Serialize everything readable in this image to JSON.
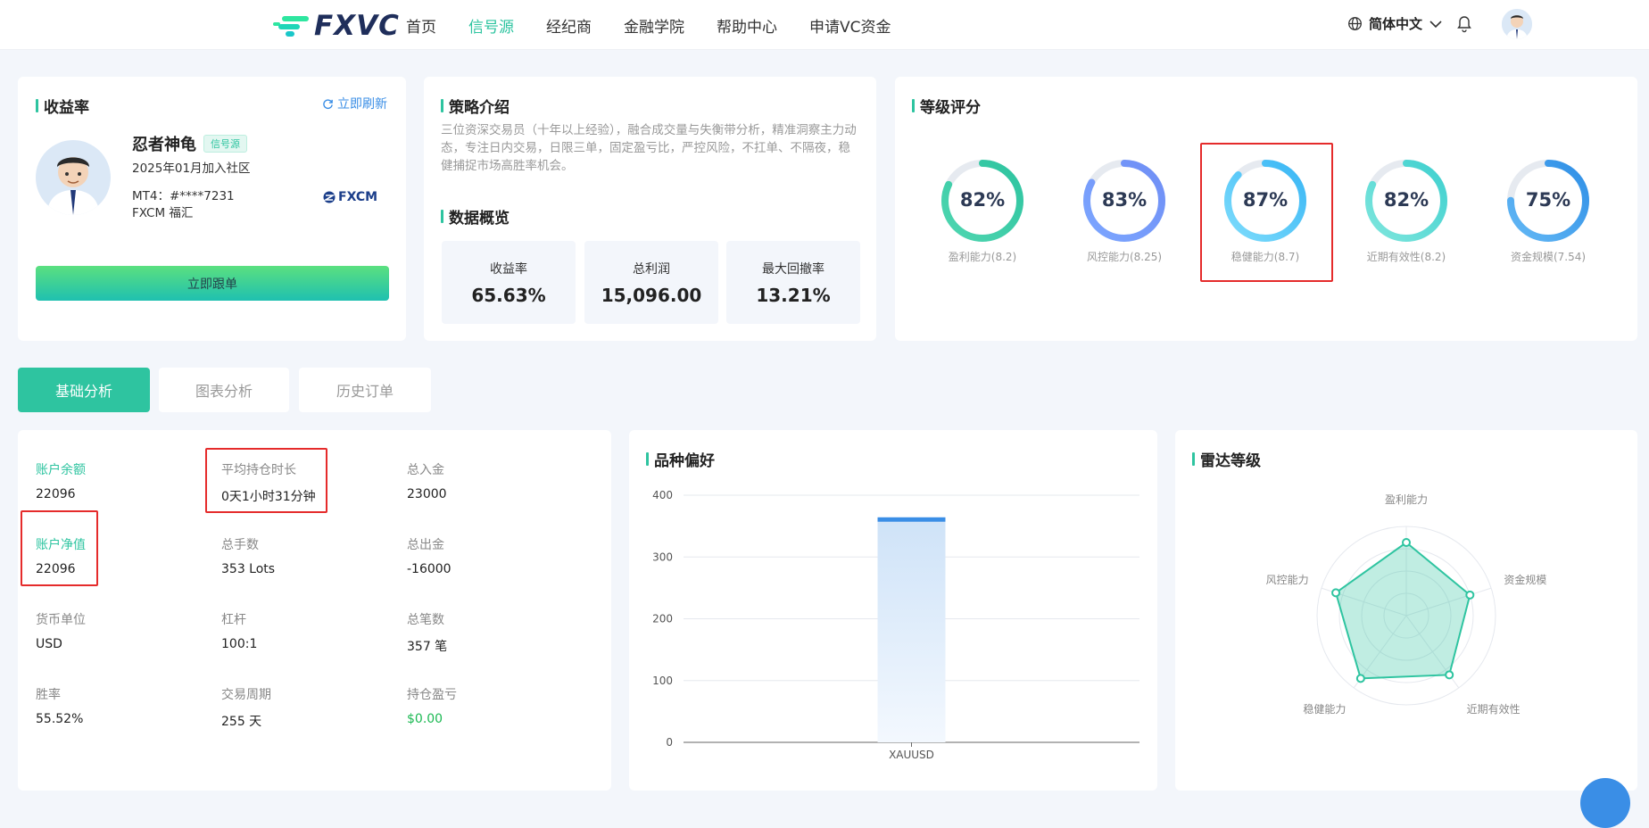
{
  "header": {
    "logo": "FXVC",
    "nav": [
      "首页",
      "信号源",
      "经纪商",
      "金融学院",
      "帮助中心",
      "申请VC资金"
    ],
    "active_nav": "信号源",
    "language": "简体中文"
  },
  "profile": {
    "section_title": "收益率",
    "refresh_label": "立即刷新",
    "name": "忍者神龟",
    "tag": "信号源",
    "joined": "2025年01月加入社区",
    "account": "MT4：#****7231",
    "broker": "FXCM 福汇",
    "broker_logo": "FXCM",
    "follow_button": "立即跟单"
  },
  "strategy": {
    "title": "策略介绍",
    "description": "三位资深交易员（十年以上经验），融合成交量与失衡带分析，精准洞察主力动态，专注日内交易，日限三单，固定盈亏比，严控风险，不扛单、不隔夜，稳健捕捉市场高胜率机会。",
    "overview_title": "数据概览",
    "stats": [
      {
        "label": "收益率",
        "value": "65.63%"
      },
      {
        "label": "总利润",
        "value": "15,096.00"
      },
      {
        "label": "最大回撤率",
        "value": "13.21%"
      }
    ]
  },
  "rating": {
    "title": "等级评分",
    "items": [
      {
        "pct": "82%",
        "fraction": 0.82,
        "label": "盈利能力(8.2)",
        "color_a": "#2ec4a0",
        "color_b": "#4fd6b0"
      },
      {
        "pct": "83%",
        "fraction": 0.83,
        "label": "风控能力(8.25)",
        "color_a": "#6f8ef5",
        "color_b": "#7ca6ff"
      },
      {
        "pct": "87%",
        "fraction": 0.87,
        "label": "稳健能力(8.7)",
        "color_a": "#39b6f5",
        "color_b": "#7ddcfc"
      },
      {
        "pct": "82%",
        "fraction": 0.82,
        "label": "近期有效性(8.2)",
        "color_a": "#3fd0cf",
        "color_b": "#7ee6dd"
      },
      {
        "pct": "75%",
        "fraction": 0.75,
        "label": "资金规模(7.54)",
        "color_a": "#2f8fe6",
        "color_b": "#63b8f5"
      }
    ]
  },
  "tabs": [
    "基础分析",
    "图表分析",
    "历史订单"
  ],
  "account_info": [
    {
      "label": "账户余额",
      "value": "22096",
      "highlight": true
    },
    {
      "label": "平均持仓时长",
      "value": "0天1小时31分钟"
    },
    {
      "label": "总入金",
      "value": "23000"
    },
    {
      "label": "账户净值",
      "value": "22096",
      "highlight": true
    },
    {
      "label": "总手数",
      "value": "353 Lots"
    },
    {
      "label": "总出金",
      "value": "-16000"
    },
    {
      "label": "货币单位",
      "value": "USD"
    },
    {
      "label": "杠杆",
      "value": "100:1"
    },
    {
      "label": "总笔数",
      "value": "357 笔"
    },
    {
      "label": "胜率",
      "value": "55.52%"
    },
    {
      "label": "交易周期",
      "value": "255 天"
    },
    {
      "label": "持仓盈亏",
      "value": "$0.00",
      "positive": true
    }
  ],
  "preference": {
    "title": "品种偏好"
  },
  "radar": {
    "title": "雷达等级",
    "axes": [
      "盈利能力",
      "资金规模",
      "近期有效性",
      "稳健能力",
      "风控能力"
    ],
    "values": [
      0.82,
      0.75,
      0.82,
      0.87,
      0.83
    ]
  },
  "chart_data": {
    "type": "bar",
    "categories": [
      "XAUUSD"
    ],
    "values": [
      357
    ],
    "ylim": [
      0,
      400
    ],
    "yticks": [
      0,
      100,
      200,
      300,
      400
    ],
    "title": "",
    "xlabel": "",
    "ylabel": ""
  }
}
